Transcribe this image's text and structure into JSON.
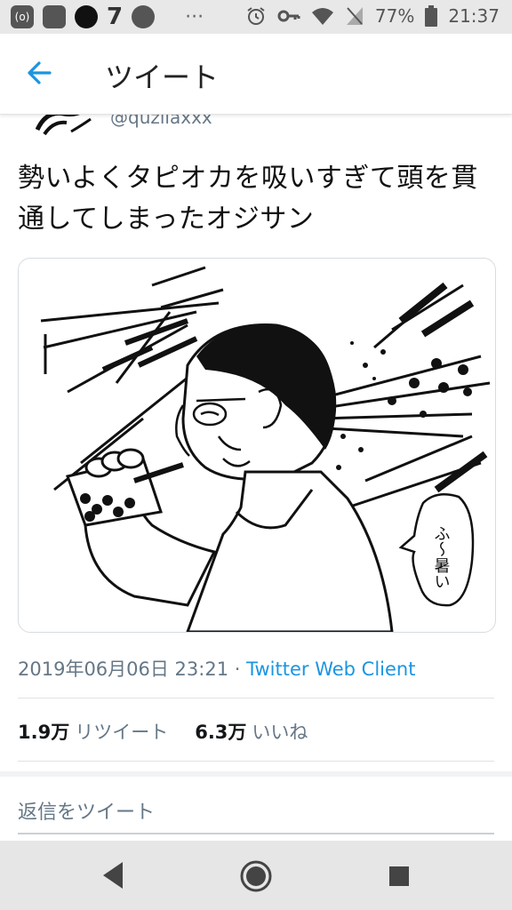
{
  "status_bar": {
    "badge": "(o)",
    "seven": "7",
    "more": "···",
    "battery": "77%",
    "time": "21:37"
  },
  "toolbar": {
    "title": "ツイート"
  },
  "tweet": {
    "handle": "@quzilaxxx",
    "text": "勢いよくタピオカを吸いすぎて頭を貫通してしまったオジサン",
    "speech_bubble": "ふ～暑い",
    "date": "2019年06月06日 23:21",
    "separator": "·",
    "client": "Twitter Web Client",
    "retweets_count": "1.9万",
    "retweets_label": "リツイート",
    "likes_count": "6.3万",
    "likes_label": "いいね"
  },
  "reply": {
    "placeholder": "返信をツイート"
  },
  "colors": {
    "accent": "#1b95e0",
    "muted": "#657786"
  }
}
